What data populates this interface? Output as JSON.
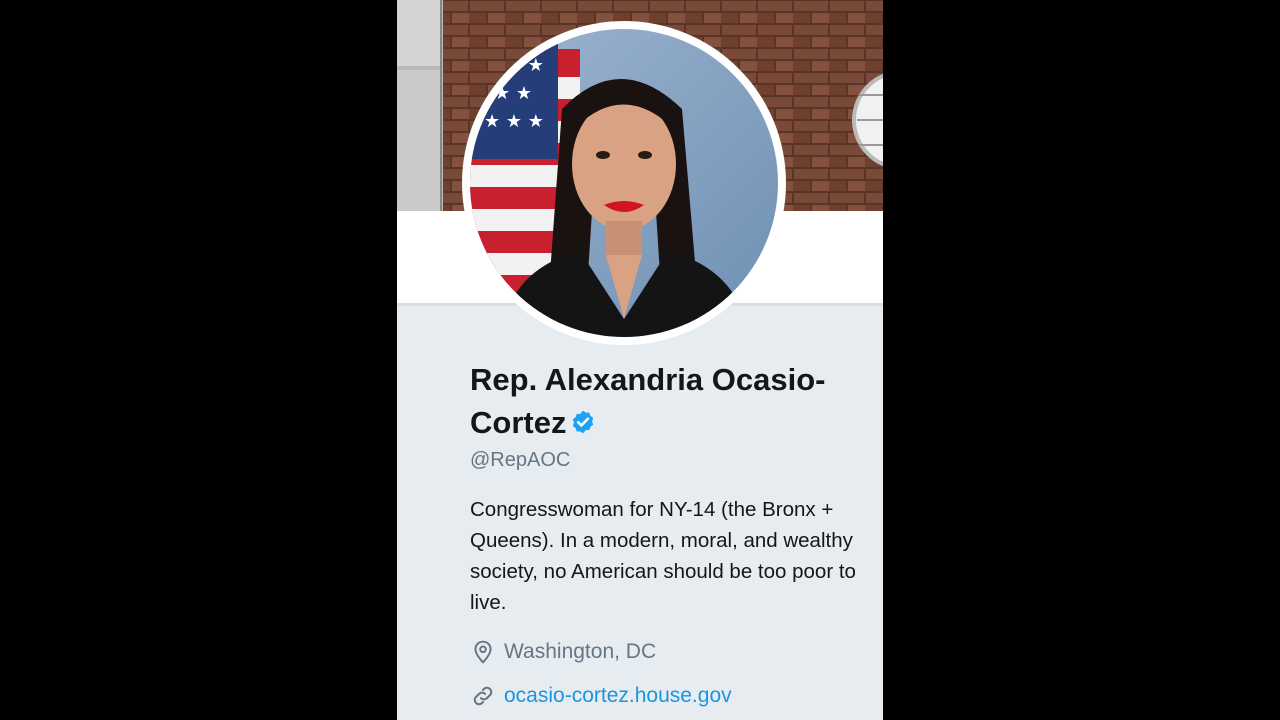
{
  "profile": {
    "name": "Rep. Alexandria Ocasio-Cortez",
    "verified_icon": "verified-badge-icon",
    "handle": "@RepAOC",
    "bio": "Congresswoman for NY-14 (the Bronx + Queens). In a modern, moral, and wealthy society, no American should be too poor to live.",
    "location": "Washington, DC",
    "location_icon": "location-pin-icon",
    "website": "ocasio-cortez.house.gov",
    "website_icon": "link-icon"
  },
  "colors": {
    "page_background": "#000000",
    "card_background": "#e6ecf0",
    "text_primary": "#14171a",
    "text_secondary": "#657786",
    "link": "#1b95e0",
    "verified": "#1da1f2"
  }
}
